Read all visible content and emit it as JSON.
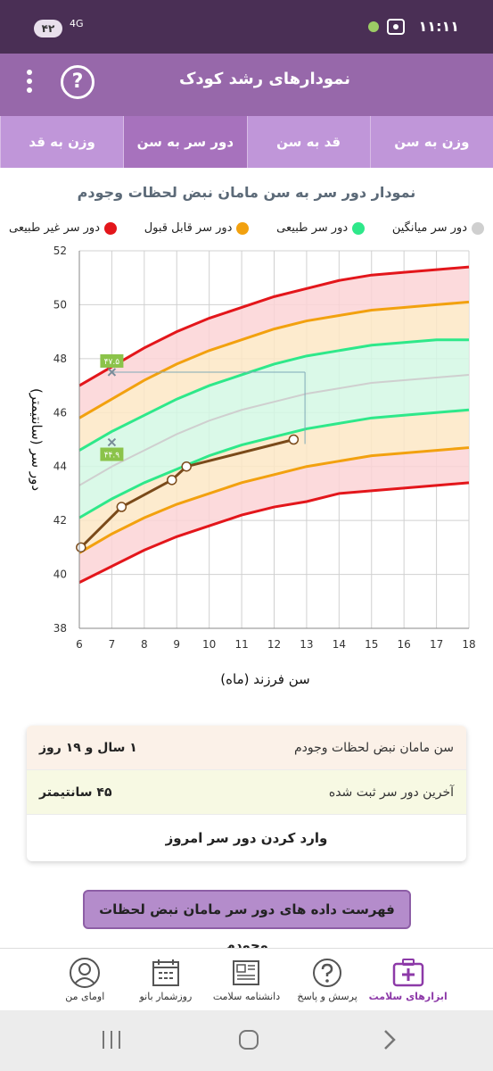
{
  "status_bar": {
    "time": "۱۱:۱۱",
    "badge": "۴۲",
    "network": "4G"
  },
  "app_bar": {
    "title": "نمودارهای رشد کودک",
    "help_label": "?"
  },
  "tabs": [
    {
      "label": "وزن به سن",
      "active": false
    },
    {
      "label": "قد به سن",
      "active": false
    },
    {
      "label": "دور سر به سن",
      "active": true
    },
    {
      "label": "وزن به قد",
      "active": false
    }
  ],
  "chart_title": "نمودار دور سر به سن مامان نبض لحظات وجودم",
  "legend": [
    {
      "label": "دور سر غیر طبیعی",
      "color": "#e3161b"
    },
    {
      "label": "دور سر قابل قبول",
      "color": "#f2a10f"
    },
    {
      "label": "دور سر طبیعی",
      "color": "#2ee88a"
    },
    {
      "label": "دور سر میانگین",
      "color": "#cfcfcf"
    }
  ],
  "chart_data": {
    "type": "line",
    "xlabel": "سن فرزند (ماه)",
    "ylabel": "دور سر (سانتیمتر)",
    "xlim": [
      6,
      18
    ],
    "ylim": [
      38,
      52
    ],
    "x_ticks": [
      6,
      7,
      8,
      9,
      10,
      11,
      12,
      13,
      14,
      15,
      16,
      17,
      18
    ],
    "y_ticks": [
      38,
      40,
      42,
      44,
      46,
      48,
      50,
      52
    ],
    "x": [
      6,
      7,
      8,
      9,
      10,
      11,
      12,
      13,
      14,
      15,
      16,
      17,
      18
    ],
    "series": [
      {
        "name": "دور سر غیر طبیعی",
        "color": "#e3161b",
        "values": [
          39.7,
          40.3,
          40.9,
          41.4,
          41.8,
          42.2,
          42.5,
          42.7,
          43.0,
          43.1,
          43.2,
          43.3,
          43.4
        ]
      },
      {
        "name": "دور سر قابل قبول",
        "color": "#f2a10f",
        "values": [
          40.8,
          41.5,
          42.1,
          42.6,
          43.0,
          43.4,
          43.7,
          44.0,
          44.2,
          44.4,
          44.5,
          44.6,
          44.7
        ]
      },
      {
        "name": "دور سر طبیعی",
        "color": "#2ee88a",
        "values": [
          42.1,
          42.8,
          43.4,
          43.9,
          44.4,
          44.8,
          45.1,
          45.4,
          45.6,
          45.8,
          45.9,
          46.0,
          46.1
        ]
      },
      {
        "name": "دور سر میانگین",
        "color": "#cfcfcf",
        "values": [
          43.3,
          44.0,
          44.6,
          45.2,
          45.7,
          46.1,
          46.4,
          46.7,
          46.9,
          47.1,
          47.2,
          47.3,
          47.4
        ]
      },
      {
        "name": "دور سر طبیعی",
        "color": "#2ee88a",
        "values": [
          44.6,
          45.3,
          45.9,
          46.5,
          47.0,
          47.4,
          47.8,
          48.1,
          48.3,
          48.5,
          48.6,
          48.7,
          48.7
        ]
      },
      {
        "name": "دور سر قابل قبول",
        "color": "#f2a10f",
        "values": [
          45.8,
          46.5,
          47.2,
          47.8,
          48.3,
          48.7,
          49.1,
          49.4,
          49.6,
          49.8,
          49.9,
          50.0,
          50.1
        ]
      },
      {
        "name": "دور سر غیر طبیعی",
        "color": "#e3161b",
        "values": [
          47.0,
          47.7,
          48.4,
          49.0,
          49.5,
          49.9,
          50.3,
          50.6,
          50.9,
          51.1,
          51.2,
          51.3,
          51.4
        ]
      }
    ],
    "child_series": {
      "color": "#7a4a1a",
      "points": [
        {
          "x": 6.05,
          "y": 41.0
        },
        {
          "x": 7.3,
          "y": 42.5
        },
        {
          "x": 8.85,
          "y": 43.5
        },
        {
          "x": 9.3,
          "y": 44.0
        },
        {
          "x": 12.6,
          "y": 45.0
        }
      ]
    },
    "markers": [
      {
        "x": 7.0,
        "y": 47.5,
        "label": "۴۷.۵"
      },
      {
        "x": 7.0,
        "y": 44.9,
        "label": "۴۴.۹"
      }
    ]
  },
  "info_card": {
    "age_label": "سن مامان نبض لحظات وجودم",
    "age_value": "۱ سال و ۱۹ روز",
    "last_label": "آخرین دور سر ثبت شده",
    "last_value": "۴۵ سانتیمتر",
    "enter_label": "وارد کردن دور سر امروز"
  },
  "list_button_label": "فهرست داده های دور سر مامان نبض لحظات وجودم",
  "bottom_nav": [
    {
      "label": "ابزارهای سلامت",
      "icon": "health-kit-icon",
      "active": true
    },
    {
      "label": "پرسش و پاسخ",
      "icon": "question-icon",
      "active": false
    },
    {
      "label": "دانشنامه سلامت",
      "icon": "newspaper-icon",
      "active": false
    },
    {
      "label": "روزشمار بانو",
      "icon": "calendar-icon",
      "active": false
    },
    {
      "label": "اومای من",
      "icon": "profile-icon",
      "active": false
    }
  ]
}
